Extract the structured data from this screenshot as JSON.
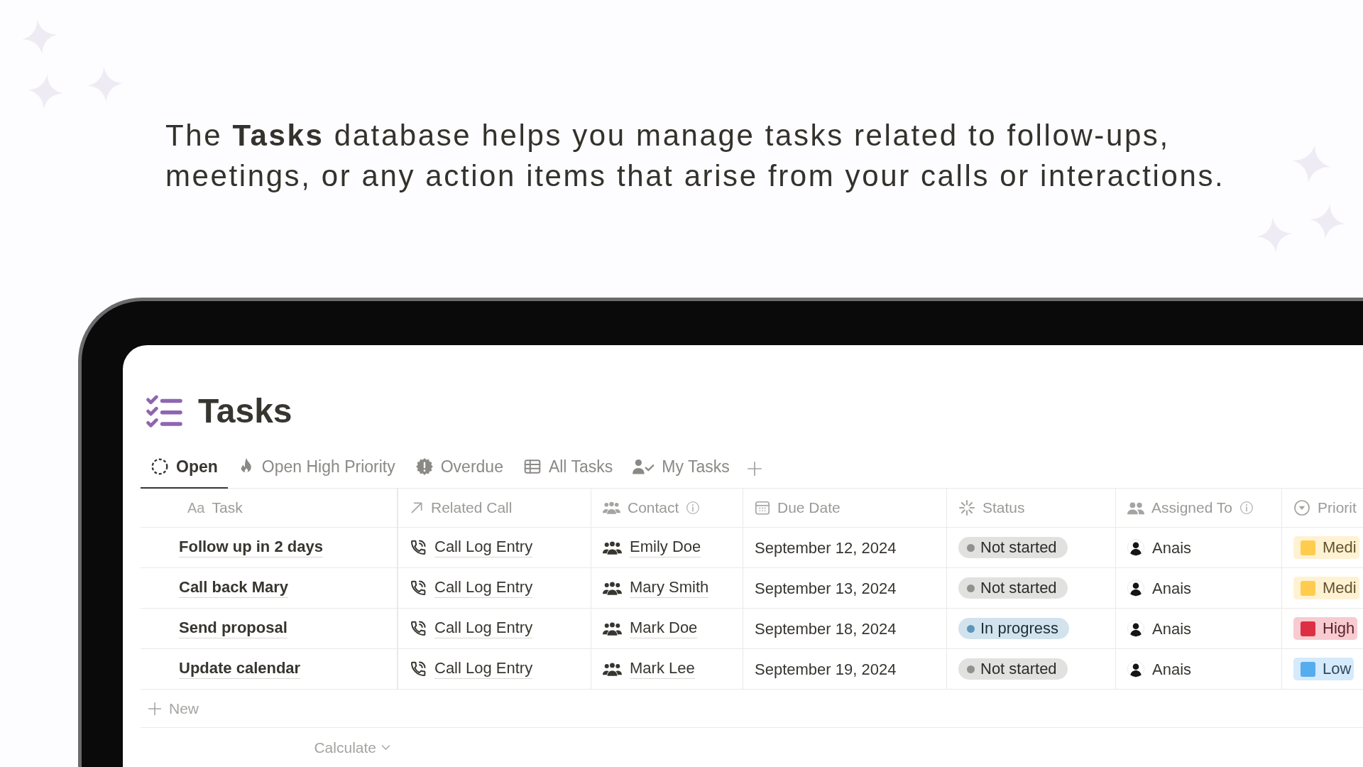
{
  "intro": {
    "text": "The **Tasks** database helps you manage tasks related to follow-ups, meetings, or any action items that arise from your calls or interactions."
  },
  "page": {
    "title": "Tasks"
  },
  "tabs": [
    {
      "label": "Open",
      "selected": true
    },
    {
      "label": "Open High Priority",
      "selected": false
    },
    {
      "label": "Overdue",
      "selected": false
    },
    {
      "label": "All Tasks",
      "selected": false
    },
    {
      "label": "My Tasks",
      "selected": false
    }
  ],
  "table": {
    "columns": [
      {
        "label": "Task",
        "kind": "title",
        "prefix": "Aa",
        "info": false
      },
      {
        "label": "Related Call",
        "kind": "call",
        "info": false
      },
      {
        "label": "Contact",
        "kind": "contact",
        "info": true
      },
      {
        "label": "Due Date",
        "kind": "date",
        "info": false
      },
      {
        "label": "Status",
        "kind": "status",
        "info": false
      },
      {
        "label": "Assigned To",
        "kind": "person",
        "info": true
      },
      {
        "label": "Priorit",
        "kind": "priority",
        "info": false
      }
    ],
    "rows": [
      {
        "cells": [
          "Follow up in 2 days",
          "Call Log Entry",
          "Emily Doe",
          "September 12, 2024",
          {
            "label": "Not started",
            "color": "#91918e"
          },
          "Anais",
          {
            "label": "Medi",
            "color": "#ffcc4d"
          }
        ]
      },
      {
        "cells": [
          "Call back Mary",
          "Call Log Entry",
          "Mary Smith",
          "September 13, 2024",
          {
            "label": "Not started",
            "color": "#91918e"
          },
          "Anais",
          {
            "label": "Medi",
            "color": "#ffcc4d"
          }
        ]
      },
      {
        "cells": [
          "Send proposal",
          "Call Log Entry",
          "Mark Doe",
          "September 18, 2024",
          {
            "label": "In progress",
            "color": "#5b97bd"
          },
          "Anais",
          {
            "label": "High",
            "color": "#dd2e44"
          }
        ]
      },
      {
        "cells": [
          "Update calendar",
          "Call Log Entry",
          "Mark Lee",
          "September 19, 2024",
          {
            "label": "Not started",
            "color": "#91918e"
          },
          "Anais",
          {
            "label": "Low",
            "color": "#55acee"
          }
        ]
      }
    ],
    "new_row": "New",
    "footer": "Calculate"
  }
}
